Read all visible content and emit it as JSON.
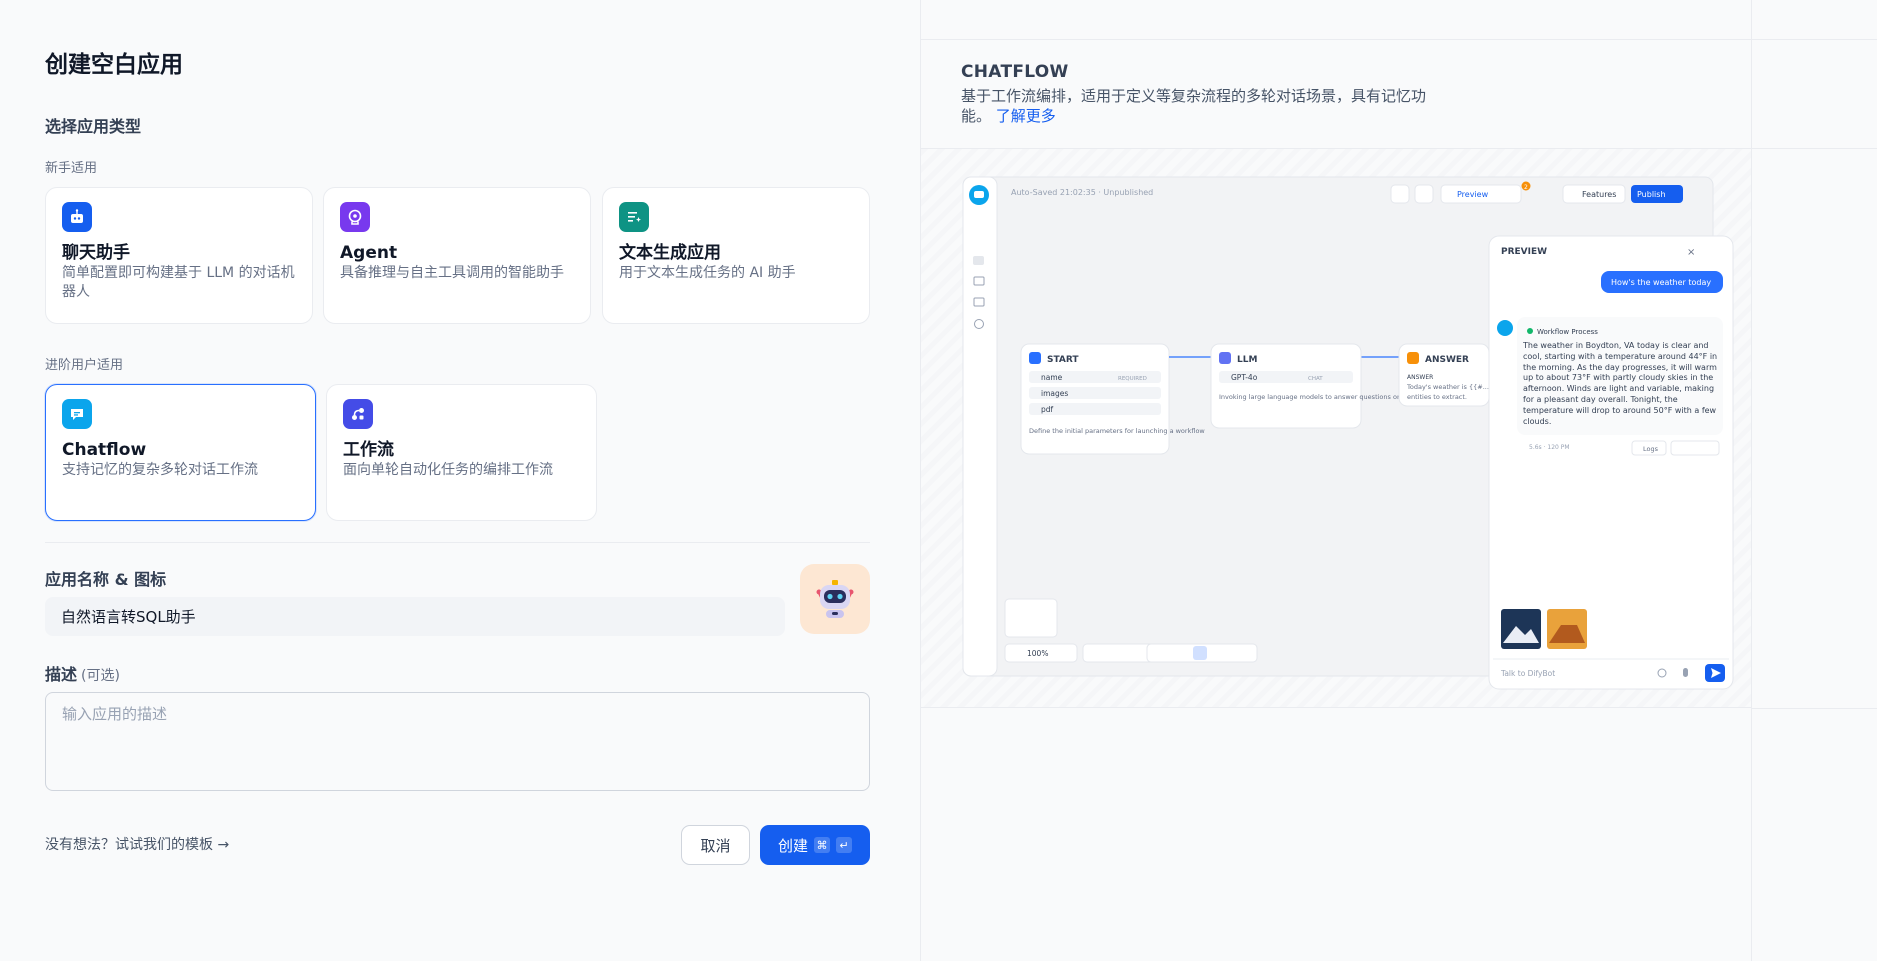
{
  "left": {
    "title": "创建空白应用",
    "choose_type": "选择应用类型",
    "beginner_label": "新手适用",
    "advanced_label": "进阶用户适用",
    "beginner_cards": [
      {
        "title": "聊天助手",
        "desc": "简单配置即可构建基于 LLM 的对话机器人",
        "icon": "chat-bot-icon",
        "color": "#155eef"
      },
      {
        "title": "Agent",
        "desc": "具备推理与自主工具调用的智能助手",
        "icon": "agent-brain-icon",
        "color": "#7839ee"
      },
      {
        "title": "文本生成应用",
        "desc": "用于文本生成任务的 AI 助手",
        "icon": "text-generation-icon",
        "color": "#0e9384"
      }
    ],
    "advanced_cards": [
      {
        "title": "Chatflow",
        "desc": "支持记忆的复杂多轮对话工作流",
        "icon": "chatflow-icon",
        "color": "#0ba5ec",
        "selected": true
      },
      {
        "title": "工作流",
        "desc": "面向单轮自动化任务的编排工作流",
        "icon": "workflow-icon",
        "color": "#444ce7"
      }
    ],
    "name_label": "应用名称 & 图标",
    "name_value": "自然语言转SQL助手",
    "desc_label": "描述",
    "desc_optional": "(可选)",
    "desc_placeholder": "输入应用的描述",
    "template_link": "没有想法？试试我们的模板 →",
    "cancel": "取消",
    "create": "创建",
    "create_kbd_1": "⌘",
    "create_kbd_2": "↵"
  },
  "right": {
    "title": "CHATFLOW",
    "desc": "基于工作流编排，适用于定义等复杂流程的多轮对话场景，具有记忆功能。",
    "learn_more": "了解更多",
    "screenshot": {
      "autosave": "Auto-Saved 21:02:35 · Unpublished",
      "preview_btn": "Preview",
      "features_btn": "Features",
      "publish_btn": "Publish",
      "badge": "2",
      "zoom": "100%",
      "panel_title": "PREVIEW",
      "user_msg": "How's the weather today",
      "workflow_process": "Workflow Process",
      "bot_msg": "The weather in Boydton, VA today is clear and cool, starting with a temperature around 44°F in the morning. As the day progresses, it will warm up to about 73°F with partly cloudy skies in the afternoon. Winds are light and variable, making for a pleasant day overall. Tonight, the temperature will drop to around 50°F with a few clouds.",
      "logs": "Logs",
      "meta": "5.6s · 120 PM",
      "input_placeholder": "Talk to DifyBot",
      "start_node": {
        "title": "START",
        "vars": [
          "name",
          "images",
          "pdf"
        ],
        "req": "REQUIRED",
        "desc": "Define the initial parameters for launching a workflow"
      },
      "llm_node": {
        "title": "LLM",
        "model": "GPT-4o",
        "tag": "CHAT",
        "desc": "Invoking large language models to answer questions or process natural language"
      },
      "answer_node": {
        "title": "ANSWER",
        "label": "ANSWER",
        "desc": "Today's weather is {{#...",
        "desc2": "entities to extract."
      }
    }
  }
}
